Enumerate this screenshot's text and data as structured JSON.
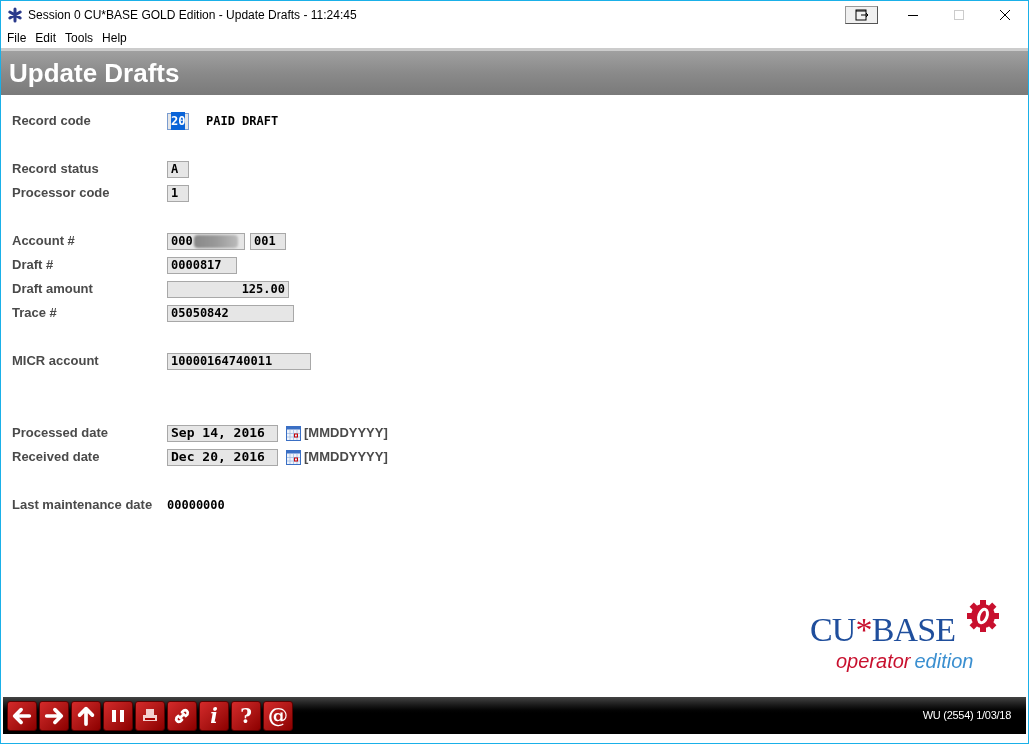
{
  "window": {
    "title": "Session 0 CU*BASE GOLD Edition - Update Drafts - 11:24:45",
    "maximize_disabled": true
  },
  "menu": [
    "File",
    "Edit",
    "Tools",
    "Help"
  ],
  "header": {
    "title": "Update Drafts"
  },
  "groups": [
    {
      "rows": [
        {
          "label": "Record code",
          "fields": [
            {
              "kind": "input",
              "value": "20",
              "focused": true
            }
          ],
          "note": "PAID DRAFT"
        }
      ]
    },
    {
      "rows": [
        {
          "label": "Record status",
          "fields": [
            {
              "kind": "input",
              "value": "A",
              "focused": false
            }
          ]
        },
        {
          "label": "Processor code",
          "fields": [
            {
              "kind": "input",
              "value": "1",
              "focused": false
            }
          ]
        }
      ]
    },
    {
      "rows": [
        {
          "label": "Account #",
          "fields": [
            {
              "kind": "redacted",
              "value": "000",
              "focused": false
            },
            {
              "kind": "input",
              "value": "001",
              "focused": false
            }
          ]
        },
        {
          "label": "Draft #",
          "fields": [
            {
              "kind": "input",
              "value": "0000817",
              "focused": false
            }
          ]
        },
        {
          "label": "Draft amount",
          "fields": [
            {
              "kind": "input",
              "value": "125.00",
              "focused": false
            }
          ]
        },
        {
          "label": "Trace #",
          "fields": [
            {
              "kind": "input",
              "value": "05050842",
              "focused": false
            }
          ]
        }
      ]
    },
    {
      "rows": [
        {
          "label": "MICR account",
          "fields": [
            {
              "kind": "input",
              "value": "10000164740011",
              "focused": false
            }
          ]
        }
      ]
    },
    {
      "rows": [
        {
          "label": "Processed date",
          "fields": [
            {
              "kind": "date",
              "value": "Sep 14, 2016",
              "focused": false,
              "hint": "[MMDDYYYY]"
            }
          ]
        },
        {
          "label": "Received date",
          "fields": [
            {
              "kind": "date",
              "value": "Dec 20, 2016",
              "focused": false,
              "hint": "[MMDDYYYY]"
            }
          ]
        }
      ]
    },
    {
      "rows": [
        {
          "label": "Last maintenance date",
          "fields": [
            {
              "kind": "plain",
              "value": "00000000",
              "focused": false
            }
          ]
        }
      ]
    }
  ],
  "logo": {
    "wordmark_1": "CU",
    "wordmark_2": "*",
    "wordmark_3": "BASE",
    "tagline_1": "operator",
    "tagline_2": "edition"
  },
  "toolbar": [
    {
      "kind": "back"
    },
    {
      "kind": "forward"
    },
    {
      "kind": "up"
    },
    {
      "kind": "pause"
    },
    {
      "kind": "print"
    },
    {
      "kind": "link"
    },
    {
      "kind": "text",
      "label": "i"
    },
    {
      "kind": "text",
      "label": "?"
    },
    {
      "kind": "text",
      "label": "@"
    }
  ],
  "status_bar": {
    "text": "WU (2554) 1/03/18"
  }
}
